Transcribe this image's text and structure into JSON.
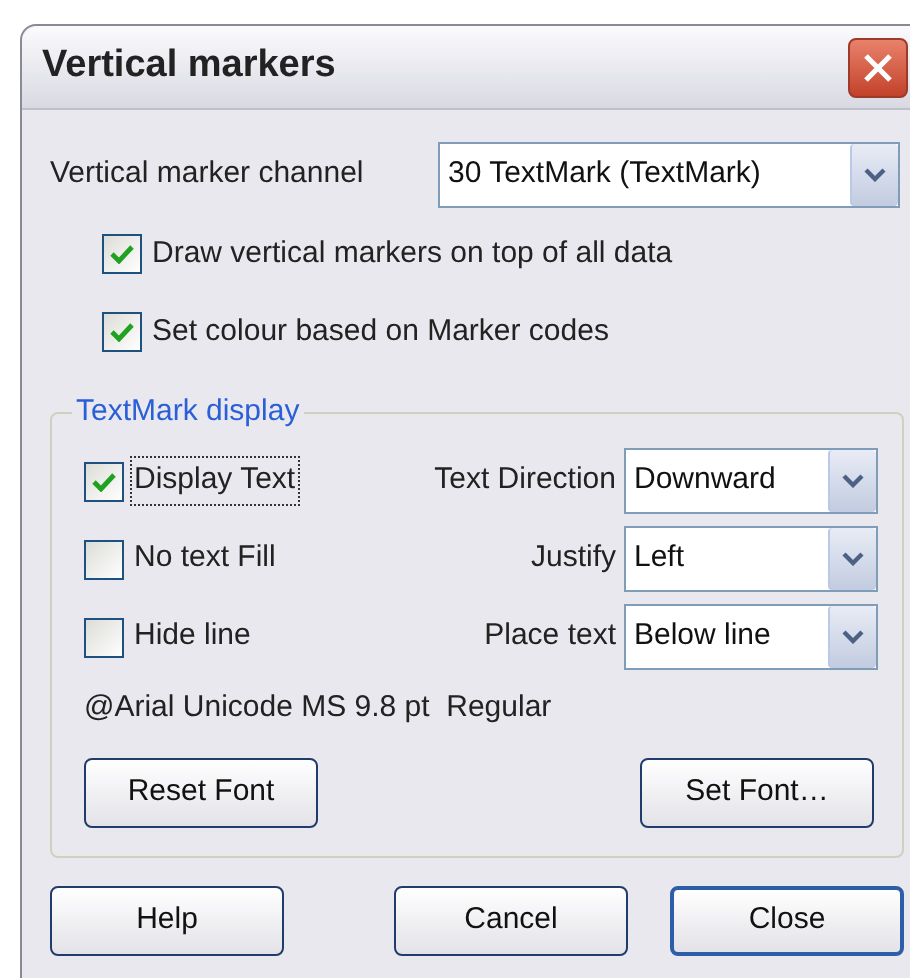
{
  "window": {
    "title": "Vertical markers"
  },
  "channel": {
    "label": "Vertical marker channel",
    "value": "30 TextMark (TextMark)"
  },
  "options": [
    {
      "label": "Draw vertical markers on top of all data",
      "checked": true
    },
    {
      "label": "Set colour based on Marker codes",
      "checked": true
    }
  ],
  "group": {
    "title": "TextMark display",
    "checkboxes": [
      {
        "label": "Display Text",
        "checked": true,
        "focused": true
      },
      {
        "label": "No text Fill",
        "checked": false,
        "focused": false
      },
      {
        "label": "Hide line",
        "checked": false,
        "focused": false
      }
    ],
    "fields": [
      {
        "label": "Text Direction",
        "value": "Downward"
      },
      {
        "label": "Justify",
        "value": "Left"
      },
      {
        "label": "Place text",
        "value": "Below line"
      }
    ],
    "font_info": "@Arial Unicode MS 9.8 pt  Regular",
    "buttons": [
      {
        "label": "Reset Font",
        "default": false
      },
      {
        "label": "Set Font…",
        "default": false
      }
    ]
  },
  "buttons": [
    {
      "label": "Help",
      "default": false
    },
    {
      "label": "Cancel",
      "default": false
    },
    {
      "label": "Close",
      "default": true
    }
  ]
}
